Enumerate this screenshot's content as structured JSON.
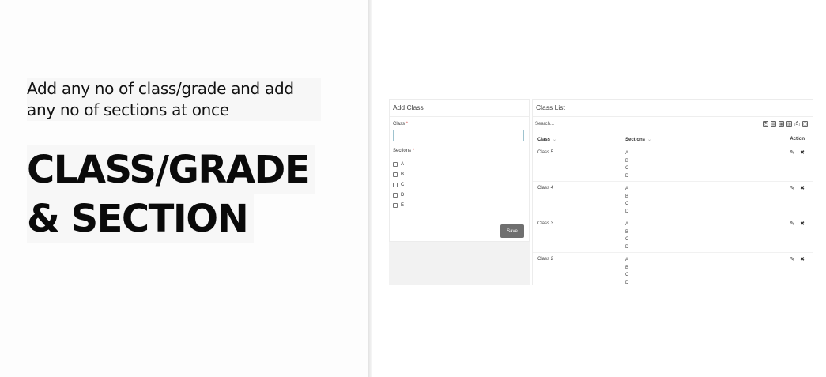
{
  "promo": {
    "tagline_line1": "Add any no of class/grade and add",
    "tagline_line2": "any no of sections at once",
    "headline_line1": "CLASS/GRADE",
    "headline_line2": "& SECTION"
  },
  "add_class": {
    "title": "Add Class",
    "class_label": "Class",
    "class_value": "",
    "sections_label": "Sections",
    "required_mark": "*",
    "section_options": [
      "A",
      "B",
      "C",
      "D",
      "E"
    ],
    "save_label": "Save"
  },
  "class_list": {
    "title": "Class List",
    "search_placeholder": "Search...",
    "toolbar_icons": [
      "copy-icon",
      "csv-icon",
      "excel-icon",
      "pdf-icon",
      "print-icon",
      "columns-icon"
    ],
    "columns": [
      "Class",
      "Sections",
      "Action"
    ],
    "rows": [
      {
        "class": "Class 5",
        "sections": [
          "A",
          "B",
          "C",
          "D"
        ]
      },
      {
        "class": "Class 4",
        "sections": [
          "A",
          "B",
          "C",
          "D"
        ]
      },
      {
        "class": "Class 3",
        "sections": [
          "A",
          "B",
          "C",
          "D"
        ]
      },
      {
        "class": "Class 2",
        "sections": [
          "A",
          "B",
          "C",
          "D"
        ]
      }
    ],
    "edit_glyph": "✎",
    "delete_glyph": "✖"
  }
}
